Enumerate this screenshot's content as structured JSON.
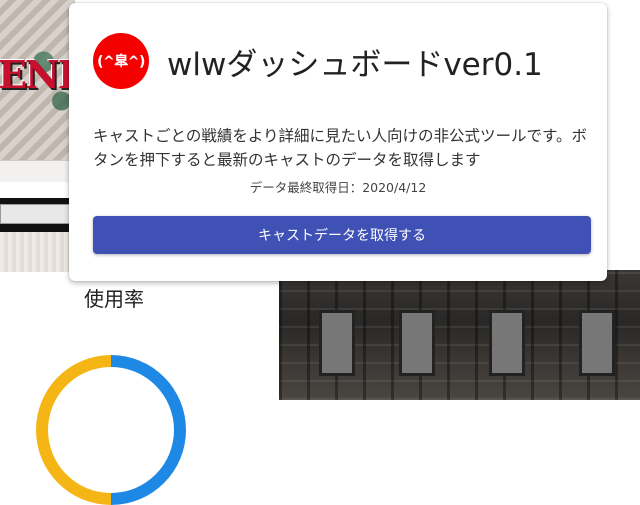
{
  "background": {
    "usage_label": "使用率",
    "logo_letters": "ENE"
  },
  "popup": {
    "avatar_text": "(^皐^)",
    "title": "wlwダッシュボードver0.1",
    "description": "キャストごとの戦績をより詳細に見たい人向けの非公式ツールです。ボタンを押下すると最新のキャストのデータを取得します",
    "last_updated": "データ最終取得日：2020/4/12",
    "fetch_button_label": "キャストデータを取得する"
  },
  "colors": {
    "accent": "#3f51b5",
    "avatar": "#f50000",
    "donut_blue": "#1e88e5",
    "donut_yellow": "#f5b514"
  }
}
